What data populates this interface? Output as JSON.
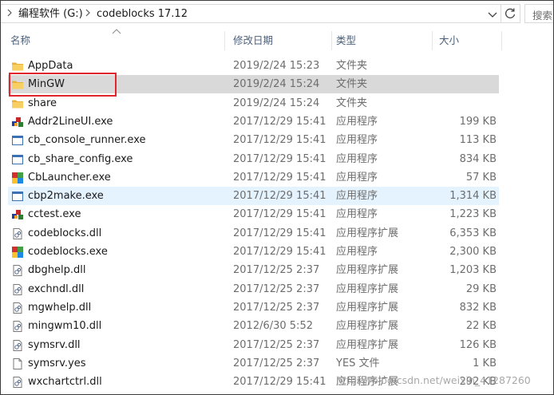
{
  "address": {
    "crumbs": [
      "编程软件 (G:)",
      "codeblocks 17.12"
    ],
    "search_placeholder": "搜索"
  },
  "columns": {
    "name": "名称",
    "date": "修改日期",
    "type": "类型",
    "size": "大小"
  },
  "files": [
    {
      "name": "AppData",
      "date": "2019/2/24 15:23",
      "type": "文件夹",
      "size": "",
      "icon": "folder-icon"
    },
    {
      "name": "MinGW",
      "date": "2019/2/24 15:24",
      "type": "文件夹",
      "size": "",
      "icon": "folder-icon"
    },
    {
      "name": "share",
      "date": "2019/2/24 15:24",
      "type": "文件夹",
      "size": "",
      "icon": "folder-icon"
    },
    {
      "name": "Addr2LineUI.exe",
      "date": "2017/12/29 15:41",
      "type": "应用程序",
      "size": "199 KB",
      "icon": "app-icon"
    },
    {
      "name": "cb_console_runner.exe",
      "date": "2017/12/29 15:41",
      "type": "应用程序",
      "size": "113 KB",
      "icon": "window-app-icon"
    },
    {
      "name": "cb_share_config.exe",
      "date": "2017/12/29 15:41",
      "type": "应用程序",
      "size": "834 KB",
      "icon": "window-app-icon"
    },
    {
      "name": "CbLauncher.exe",
      "date": "2017/12/29 15:41",
      "type": "应用程序",
      "size": "57 KB",
      "icon": "codeblocks-icon"
    },
    {
      "name": "cbp2make.exe",
      "date": "2017/12/29 15:41",
      "type": "应用程序",
      "size": "1,314 KB",
      "icon": "window-app-icon"
    },
    {
      "name": "cctest.exe",
      "date": "2017/12/29 15:41",
      "type": "应用程序",
      "size": "1,223 KB",
      "icon": "app-icon"
    },
    {
      "name": "codeblocks.dll",
      "date": "2017/12/29 15:41",
      "type": "应用程序扩展",
      "size": "6,353 KB",
      "icon": "dll-icon"
    },
    {
      "name": "codeblocks.exe",
      "date": "2017/12/29 15:41",
      "type": "应用程序",
      "size": "2,300 KB",
      "icon": "codeblocks-icon"
    },
    {
      "name": "dbghelp.dll",
      "date": "2017/12/25 2:37",
      "type": "应用程序扩展",
      "size": "1,203 KB",
      "icon": "dll-icon"
    },
    {
      "name": "exchndl.dll",
      "date": "2017/12/25 2:37",
      "type": "应用程序扩展",
      "size": "29 KB",
      "icon": "dll-icon"
    },
    {
      "name": "mgwhelp.dll",
      "date": "2017/12/25 2:37",
      "type": "应用程序扩展",
      "size": "832 KB",
      "icon": "dll-icon"
    },
    {
      "name": "mingwm10.dll",
      "date": "2012/6/30 5:52",
      "type": "应用程序扩展",
      "size": "22 KB",
      "icon": "dll-icon"
    },
    {
      "name": "symsrv.dll",
      "date": "2017/12/25 2:37",
      "type": "应用程序扩展",
      "size": "126 KB",
      "icon": "dll-icon"
    },
    {
      "name": "symsrv.yes",
      "date": "2017/12/25 2:37",
      "type": "YES 文件",
      "size": "1 KB",
      "icon": "blank-file-icon"
    },
    {
      "name": "wxchartctrl.dll",
      "date": "2017/12/29 15:41",
      "type": "应用程序扩展",
      "size": "292 KB",
      "icon": "dll-icon"
    }
  ],
  "selected_index": 1,
  "hover_index": 7,
  "watermark": "https://blog.csdn.net/weixin_41287260",
  "colors": {
    "selected_row": "#d9d9d9",
    "hover_row": "#e5f3ff",
    "highlight_box": "#e0262c",
    "folder": "#f2c055"
  }
}
